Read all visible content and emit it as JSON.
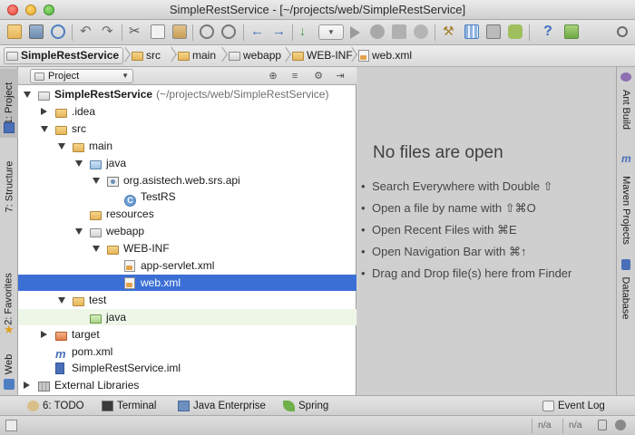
{
  "window": {
    "title": "SimpleRestService - [~/projects/web/SimpleRestService]"
  },
  "colors": {
    "selection": "#3b6fd6",
    "editor_bg": "#cfcfcf",
    "tree_bg": "#ffffff"
  },
  "breadcrumbs": [
    {
      "label": "SimpleRestService",
      "icon": "project-folder-icon"
    },
    {
      "label": "src",
      "icon": "folder-icon"
    },
    {
      "label": "main",
      "icon": "folder-icon"
    },
    {
      "label": "webapp",
      "icon": "web-folder-icon"
    },
    {
      "label": "WEB-INF",
      "icon": "folder-icon"
    },
    {
      "label": "web.xml",
      "icon": "xml-file-icon"
    }
  ],
  "project_panel": {
    "view_selector": "Project",
    "tree": [
      {
        "name": "SimpleRestService",
        "suffix": "(~/projects/web/SimpleRestService)",
        "depth": 0,
        "expand": "down",
        "icon": "project-folder-icon",
        "bold": true
      },
      {
        "name": ".idea",
        "depth": 1,
        "expand": "right",
        "icon": "folder-icon"
      },
      {
        "name": "src",
        "depth": 1,
        "expand": "down",
        "icon": "folder-icon"
      },
      {
        "name": "main",
        "depth": 2,
        "expand": "down",
        "icon": "folder-icon"
      },
      {
        "name": "java",
        "depth": 3,
        "expand": "down",
        "icon": "source-folder-icon"
      },
      {
        "name": "org.asistech.web.srs.api",
        "depth": 4,
        "expand": "down",
        "icon": "package-icon"
      },
      {
        "name": "TestRS",
        "depth": 5,
        "expand": "none",
        "icon": "class-icon"
      },
      {
        "name": "resources",
        "depth": 3,
        "expand": "none",
        "icon": "resources-folder-icon"
      },
      {
        "name": "webapp",
        "depth": 3,
        "expand": "down",
        "icon": "web-folder-icon"
      },
      {
        "name": "WEB-INF",
        "depth": 4,
        "expand": "down",
        "icon": "folder-icon"
      },
      {
        "name": "app-servlet.xml",
        "depth": 5,
        "expand": "none",
        "icon": "xml-file-icon"
      },
      {
        "name": "web.xml",
        "depth": 5,
        "expand": "none",
        "icon": "xml-file-icon",
        "selected": true
      },
      {
        "name": "test",
        "depth": 2,
        "expand": "down",
        "icon": "folder-icon"
      },
      {
        "name": "java",
        "depth": 3,
        "expand": "none",
        "icon": "test-folder-icon",
        "highlight": true
      },
      {
        "name": "target",
        "depth": 1,
        "expand": "right",
        "icon": "excluded-folder-icon"
      },
      {
        "name": "pom.xml",
        "depth": 1,
        "expand": "none",
        "icon": "maven-icon"
      },
      {
        "name": "SimpleRestService.iml",
        "depth": 1,
        "expand": "none",
        "icon": "iml-file-icon"
      },
      {
        "name": "External Libraries",
        "depth": 0,
        "expand": "right",
        "icon": "library-icon"
      }
    ]
  },
  "editor": {
    "empty_title": "No files are open",
    "tips": [
      "Search Everywhere with Double ⇧",
      "Open a file by name with ⇧⌘O",
      "Open Recent Files with ⌘E",
      "Open Navigation Bar with ⌘↑",
      "Drag and Drop file(s) here from Finder"
    ]
  },
  "left_tabs": {
    "project": "1: Project",
    "structure": "7: Structure",
    "favorites": "2: Favorites",
    "web": "Web"
  },
  "right_tabs": {
    "ant": "Ant Build",
    "maven": "Maven Projects",
    "database": "Database"
  },
  "bottom_tabs": {
    "todo": "6: TODO",
    "terminal": "Terminal",
    "java_enterprise": "Java Enterprise",
    "spring": "Spring",
    "event_log": "Event Log"
  },
  "status": {
    "na1": "n/a",
    "na2": "n/a"
  }
}
